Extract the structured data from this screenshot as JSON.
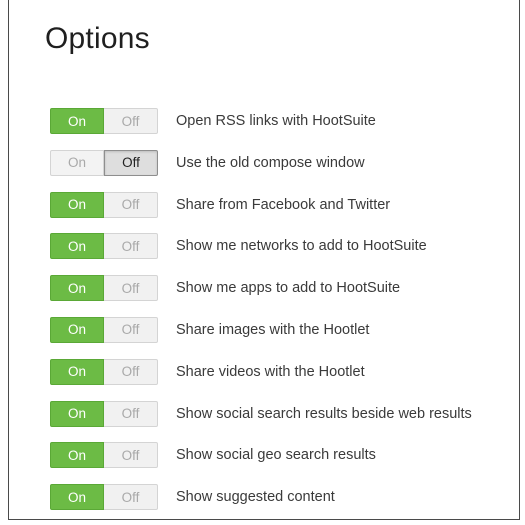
{
  "page": {
    "title": "Options"
  },
  "toggle_labels": {
    "on": "On",
    "off": "Off"
  },
  "colors": {
    "on_active": "#6cbb45",
    "off_active": "#dedede",
    "inactive": "#f1f1f1"
  },
  "options": [
    {
      "label": "Open RSS links with HootSuite",
      "state": "on"
    },
    {
      "label": "Use the old compose window",
      "state": "off"
    },
    {
      "label": "Share from Facebook and Twitter",
      "state": "on"
    },
    {
      "label": "Show me networks to add to HootSuite",
      "state": "on"
    },
    {
      "label": "Show me apps to add to HootSuite",
      "state": "on"
    },
    {
      "label": "Share images with the Hootlet",
      "state": "on"
    },
    {
      "label": "Share videos with the Hootlet",
      "state": "on"
    },
    {
      "label": "Show social search results beside web results",
      "state": "on"
    },
    {
      "label": "Show social geo search results",
      "state": "on"
    },
    {
      "label": "Show suggested content",
      "state": "on"
    }
  ]
}
